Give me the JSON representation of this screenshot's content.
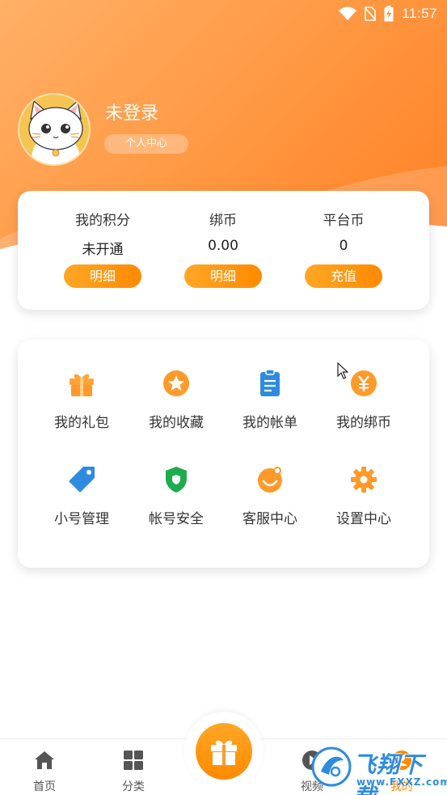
{
  "status_bar": {
    "time": "11:57"
  },
  "profile": {
    "name": "未登录",
    "center_link": "个人中心"
  },
  "points": [
    {
      "label": "我的积分",
      "value": "未开通",
      "button": "明细"
    },
    {
      "label": "绑币",
      "value": "0.00",
      "button": "明细"
    },
    {
      "label": "平台币",
      "value": "0",
      "button": "充值"
    }
  ],
  "menu": [
    {
      "label": "我的礼包",
      "icon": "gift-icon"
    },
    {
      "label": "我的收藏",
      "icon": "star-icon"
    },
    {
      "label": "我的帐单",
      "icon": "bill-icon"
    },
    {
      "label": "我的绑币",
      "icon": "yen-coin-icon"
    },
    {
      "label": "小号管理",
      "icon": "tag-icon"
    },
    {
      "label": "帐号安全",
      "icon": "shield-icon"
    },
    {
      "label": "客服中心",
      "icon": "smile-icon"
    },
    {
      "label": "设置中心",
      "icon": "gear-icon"
    }
  ],
  "tabbar": {
    "items": [
      {
        "label": "首页",
        "icon": "home-icon"
      },
      {
        "label": "分类",
        "icon": "grid-icon"
      },
      {
        "label": "视频",
        "icon": "video-icon"
      },
      {
        "label": "我的",
        "icon": "profile-icon"
      }
    ],
    "active": "我的"
  },
  "watermark": {
    "title": "飞翔下载",
    "sub": "www.FXXZ.com"
  },
  "colors": {
    "accent": "#ff8a00",
    "header": "#ff9640",
    "blue": "#2f8be0",
    "green": "#1fab4f"
  }
}
